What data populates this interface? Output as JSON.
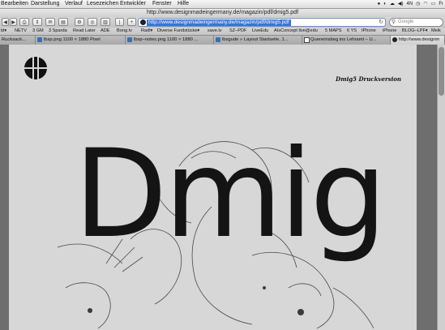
{
  "menubar": {
    "items": [
      "Bearbeiten",
      "Darstellung",
      "Verlauf",
      "Lesezeichen",
      "Entwickler",
      "Fenster",
      "Hilfe"
    ],
    "status": [
      "4N",
      "Fr"
    ]
  },
  "window": {
    "title": "http://www.designmadeingermany.de/magazin/pdf/dmig5.pdf"
  },
  "toolbar": {
    "address_value": "http://www.designmadeingermany.de/magazin/pdf/dmig5.pdf",
    "search_placeholder": "Google"
  },
  "bookmarks": [
    "NETV",
    "3 GM",
    "3 Sparda",
    "Read Later",
    "ADE",
    "Bong.tv",
    "Radl▾",
    "Diverse Fundstücke▾",
    "save.tv",
    "SZ–PDF",
    "LiveEdu",
    "AIsConcept live@edu",
    "5 MAPS",
    "6 YS",
    "IPhone",
    "iPhone",
    "BLOG–LPF▾",
    "Meik"
  ],
  "tabs": [
    {
      "label": "Rucksack..."
    },
    {
      "label": "lbsp.png 1100 × 1880 Pixel"
    },
    {
      "label": "lbsp–notes.png 1100 × 1880 ..."
    },
    {
      "label": "lbsgude » Layout Startseite, 1..."
    },
    {
      "label": "Queneinstieg ins Lehramt – U..."
    },
    {
      "label": "http://www.designm"
    }
  ],
  "pdf": {
    "header_right": "Dmig5 Druckversion",
    "big_word": "Dmig"
  }
}
